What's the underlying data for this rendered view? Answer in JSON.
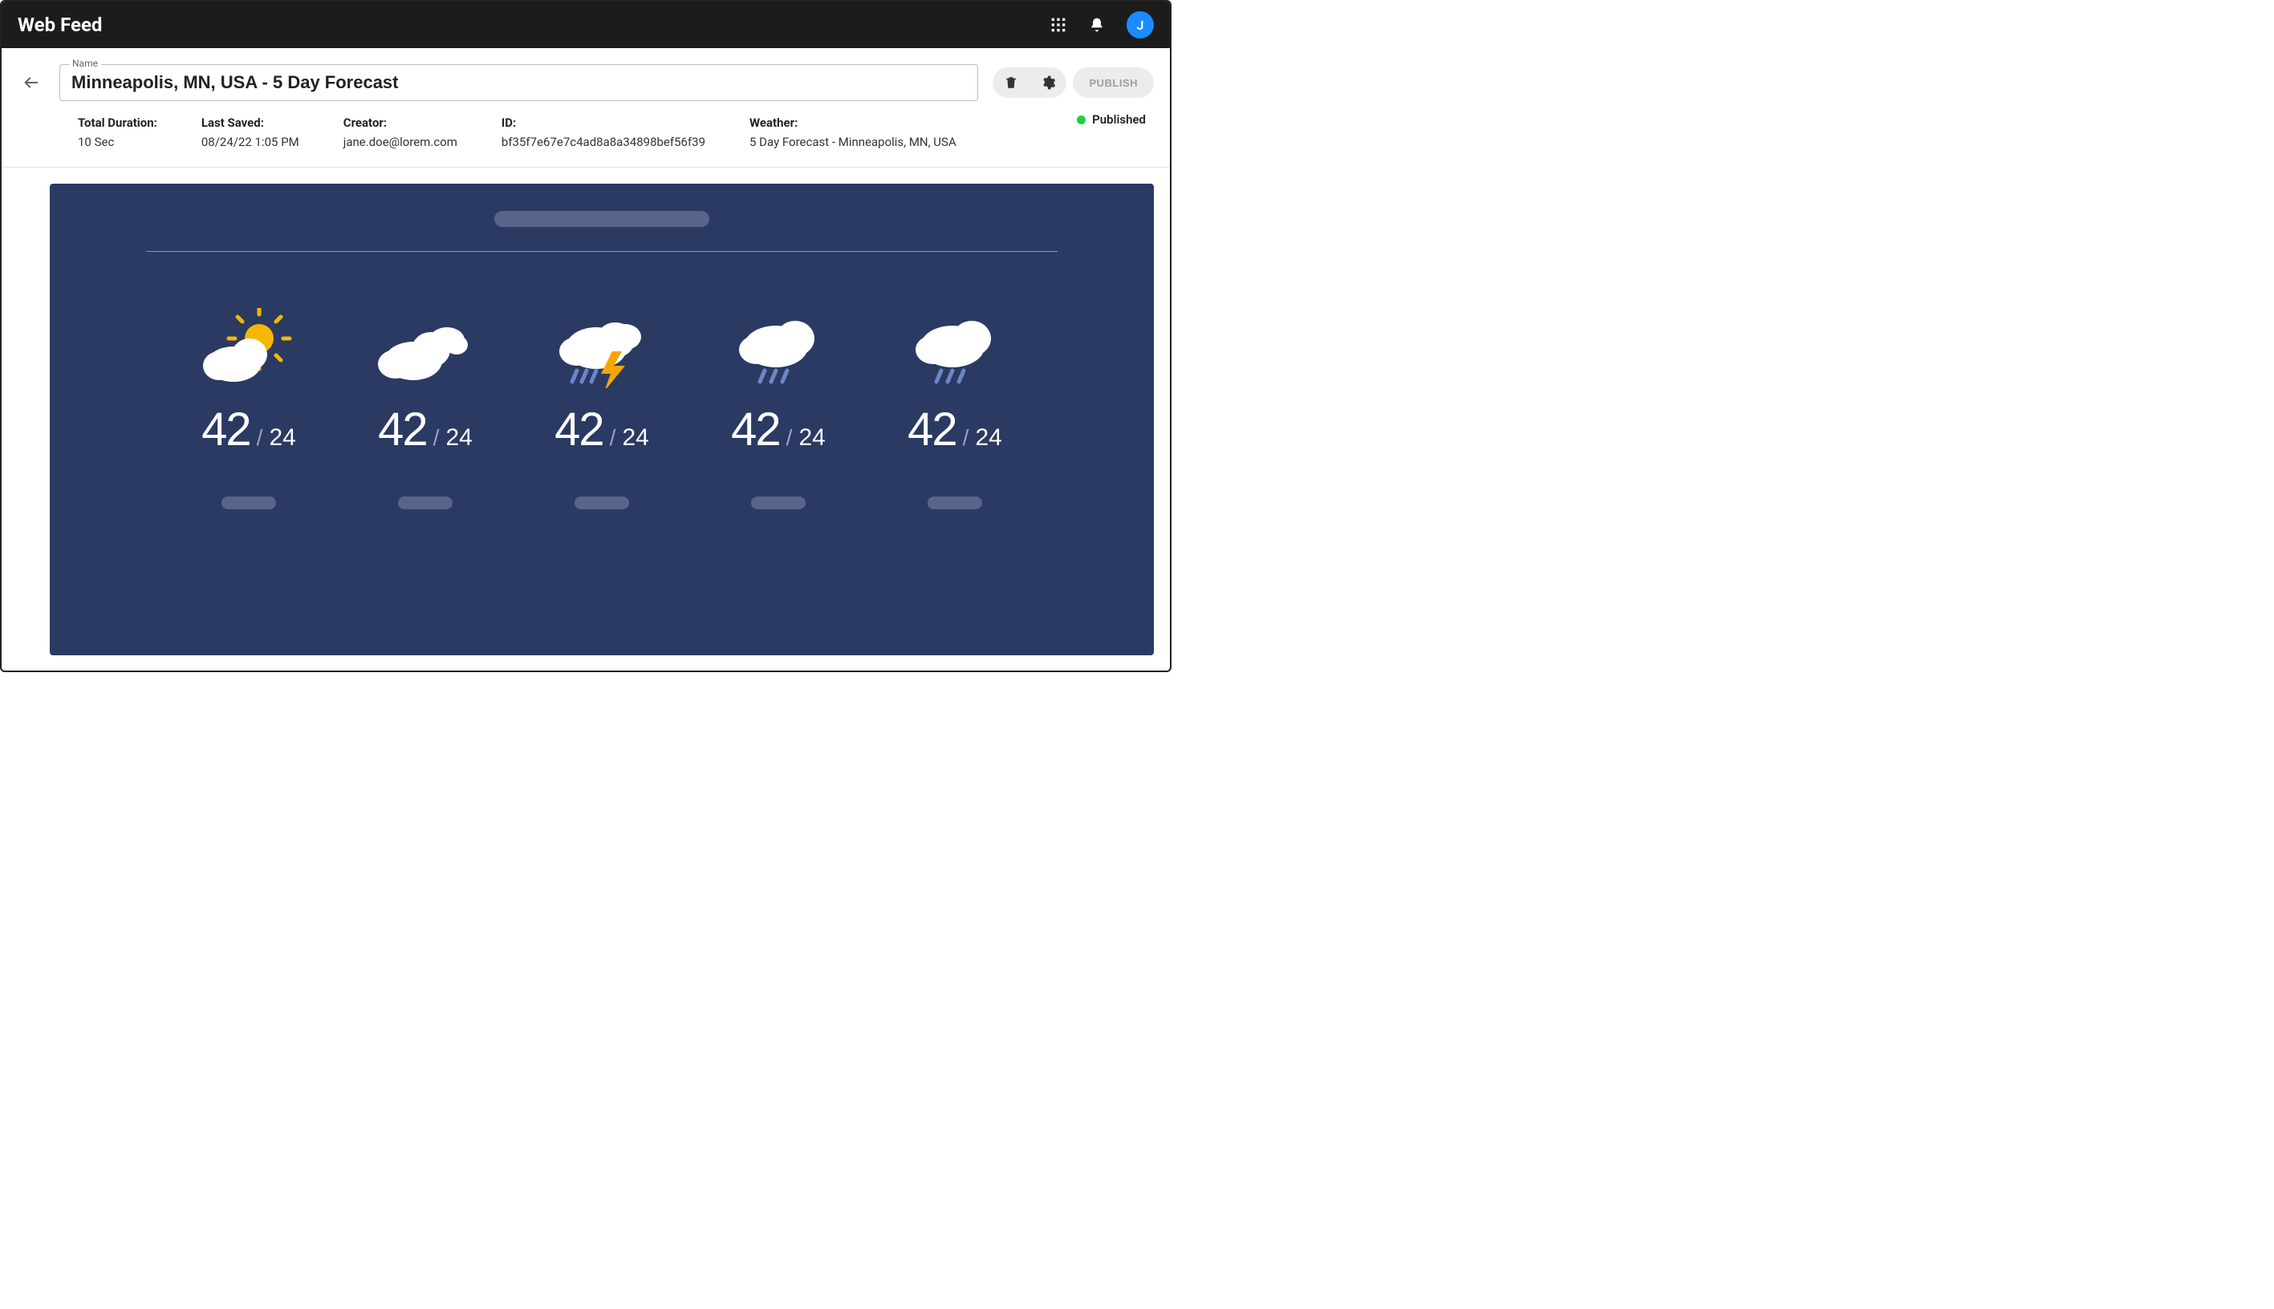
{
  "app": {
    "title": "Web Feed"
  },
  "header": {
    "name_label": "Name",
    "name_value": "Minneapolis, MN, USA - 5 Day Forecast",
    "publish_label": "PUBLISH",
    "avatar_initial": "J"
  },
  "meta": {
    "total_duration": {
      "label": "Total Duration:",
      "value": "10 Sec"
    },
    "last_saved": {
      "label": "Last Saved:",
      "value": "08/24/22 1:05 PM"
    },
    "creator": {
      "label": "Creator:",
      "value": "jane.doe@lorem.com"
    },
    "id": {
      "label": "ID:",
      "value": "bf35f7e67e7c4ad8a8a34898bef56f39"
    },
    "weather": {
      "label": "Weather:",
      "value": "5 Day Forecast - Minneapolis, MN, USA"
    },
    "status": {
      "value": "Published"
    }
  },
  "forecast": {
    "days": [
      {
        "icon": "partly-sunny",
        "hi": "42",
        "lo": "24"
      },
      {
        "icon": "cloudy",
        "hi": "42",
        "lo": "24"
      },
      {
        "icon": "thunderstorm",
        "hi": "42",
        "lo": "24"
      },
      {
        "icon": "rain",
        "hi": "42",
        "lo": "24"
      },
      {
        "icon": "rain",
        "hi": "42",
        "lo": "24"
      }
    ]
  }
}
